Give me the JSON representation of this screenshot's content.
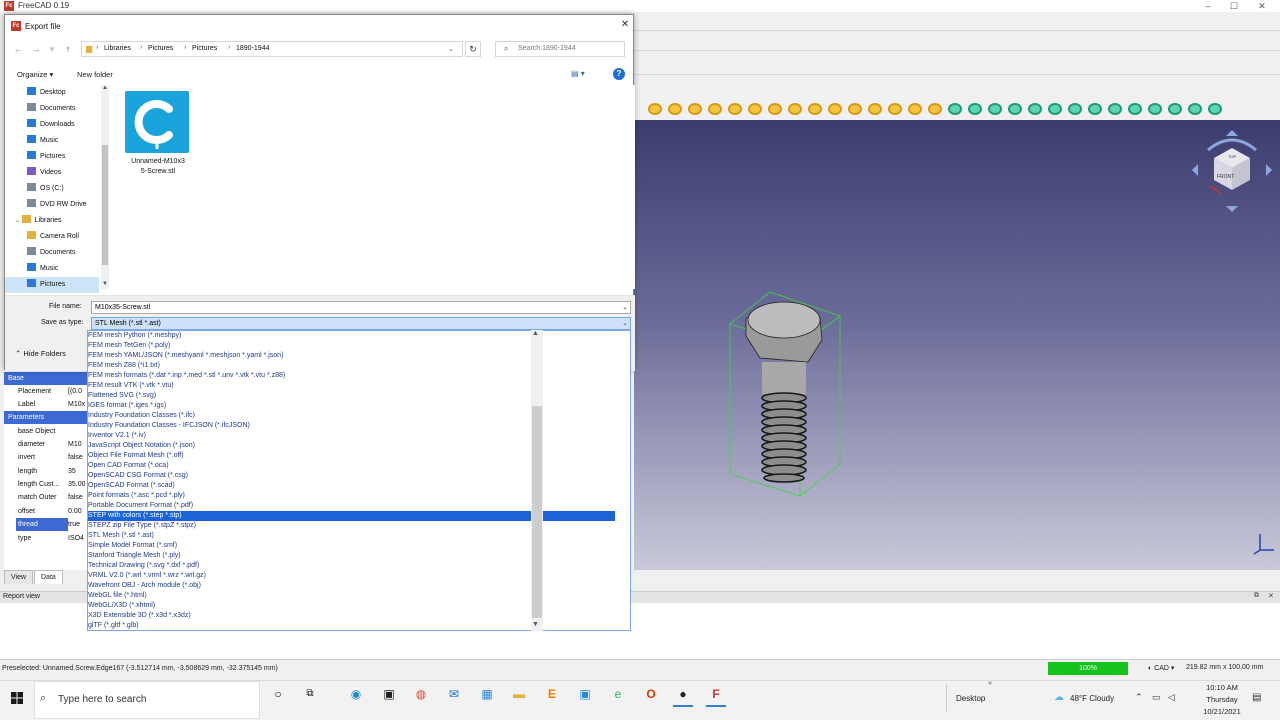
{
  "app": {
    "title": "FreeCAD 0.19"
  },
  "toolbar_nuts": {
    "gold_count": 15,
    "green_count": 14
  },
  "dialog": {
    "title": "Export file",
    "breadcrumbs": [
      "Libraries",
      "Pictures",
      "Pictures",
      "1890-1944"
    ],
    "search_placeholder": "Search 1890-1944",
    "organize_label": "Organize",
    "new_folder_label": "New folder",
    "tree_items": [
      {
        "label": "Desktop",
        "icon": "desktop-icon",
        "color": "#2b7bd6"
      },
      {
        "label": "Documents",
        "icon": "documents-icon",
        "color": "#7a8a99"
      },
      {
        "label": "Downloads",
        "icon": "downloads-icon",
        "color": "#2b7bd6"
      },
      {
        "label": "Music",
        "icon": "music-icon",
        "color": "#2b7bd6"
      },
      {
        "label": "Pictures",
        "icon": "pictures-icon",
        "color": "#2b7bd6"
      },
      {
        "label": "Videos",
        "icon": "videos-icon",
        "color": "#7a5cc6"
      },
      {
        "label": "OS (C:)",
        "icon": "drive-icon",
        "color": "#7a8a99"
      },
      {
        "label": "DVD RW Drive",
        "icon": "dvd-icon",
        "color": "#7a8a99"
      },
      {
        "label": "Libraries",
        "icon": "libraries-icon",
        "color": "#e3b23c"
      },
      {
        "label": "Camera Roll",
        "icon": "folder-icon",
        "color": "#e3b23c"
      },
      {
        "label": "Documents",
        "icon": "documents-icon",
        "color": "#7a8a99"
      },
      {
        "label": "Music",
        "icon": "music-icon",
        "color": "#2b7bd6"
      },
      {
        "label": "Pictures",
        "icon": "pictures-icon",
        "color": "#2b7bd6"
      }
    ],
    "file": {
      "name_line1": "Unnamed-M10x3",
      "name_line2": "5-Screw.stl"
    },
    "file_name_label": "File name:",
    "file_name_value": "M10x35-Screw.stl",
    "save_type_label": "Save as type:",
    "save_type_value": "STL Mesh (*.stl *.ast)",
    "hide_folders_label": "Hide Folders",
    "dropdown_options": [
      "FEM mesh Python (*.meshpy)",
      "FEM mesh TetGen (*.poly)",
      "FEM mesh YAML/JSON (*.meshyaml *.meshjson *.yaml *.json)",
      "FEM mesh Z88 (*i1.txt)",
      "FEM mesh formats (*.dat *.inp *.med *.stl *.unv *.vtk *.vtu *.z88)",
      "FEM result VTK (*.vtk *.vtu)",
      "Flattened SVG (*.svg)",
      "IGES format (*.iges *.igs)",
      "Industry Foundation Classes (*.ifc)",
      "Industry Foundation Classes - IFCJSON (*.ifcJSON)",
      "Inventor V2.1 (*.iv)",
      "JavaScript Object Notation (*.json)",
      "Object File Format Mesh (*.off)",
      "Open CAD Format (*.oca)",
      "OpenSCAD CSG Format (*.csg)",
      "OpenSCAD Format (*.scad)",
      "Point formats (*.asc *.pcd *.ply)",
      "Portable Document Format (*.pdf)",
      "STEP with colors (*.step *.stp)",
      "STEPZ zip File Type (*.stpZ *.stpz)",
      "STL Mesh (*.stl *.ast)",
      "Simple Model Format (*.smf)",
      "Stanford Triangle Mesh (*.ply)",
      "Technical Drawing (*.svg *.dxf *.pdf)",
      "VRML V2.0 (*.wrl *.vrml *.wrz *.wrl.gz)",
      "Wavefront OBJ - Arch module (*.obj)",
      "WebGL file (*.html)",
      "WebGL/X3D (*.xhtml)",
      "X3D Extensible 3D (*.x3d *.x3dz)",
      "glTF (*.gltf *.glb)"
    ],
    "selected_option_index": 18
  },
  "properties": {
    "groups": [
      "Base",
      "Parameters"
    ],
    "rows": [
      {
        "key": "Placement",
        "value": "[(0.0"
      },
      {
        "key": "Label",
        "value": "M10x"
      },
      {
        "key": "base Object",
        "value": ""
      },
      {
        "key": "diameter",
        "value": "M10"
      },
      {
        "key": "invert",
        "value": "false"
      },
      {
        "key": "length",
        "value": "35"
      },
      {
        "key": "length Cust...",
        "value": "35.00"
      },
      {
        "key": "match Outer",
        "value": "false"
      },
      {
        "key": "offset",
        "value": "0.00"
      },
      {
        "key": "thread",
        "value": "true"
      },
      {
        "key": "type",
        "value": "ISO4"
      }
    ],
    "selected_key": "thread",
    "tabs": [
      "View",
      "Data"
    ]
  },
  "report_view": {
    "label": "Report view"
  },
  "status": {
    "text": "Preselected: Unnamed.Screw.Edge167 (-3.512714 mm, -3.508629 mm, -32.375145 mm)",
    "progress": "100%",
    "navigation": "CAD",
    "dimensions": "219.82 mm x 100.00 mm"
  },
  "taskbar": {
    "search_placeholder": "Type here to search",
    "desktop_label": "Desktop",
    "weather": "48°F  Cloudy",
    "time": "10:10 AM",
    "day": "Thursday",
    "date": "10/21/2021"
  }
}
